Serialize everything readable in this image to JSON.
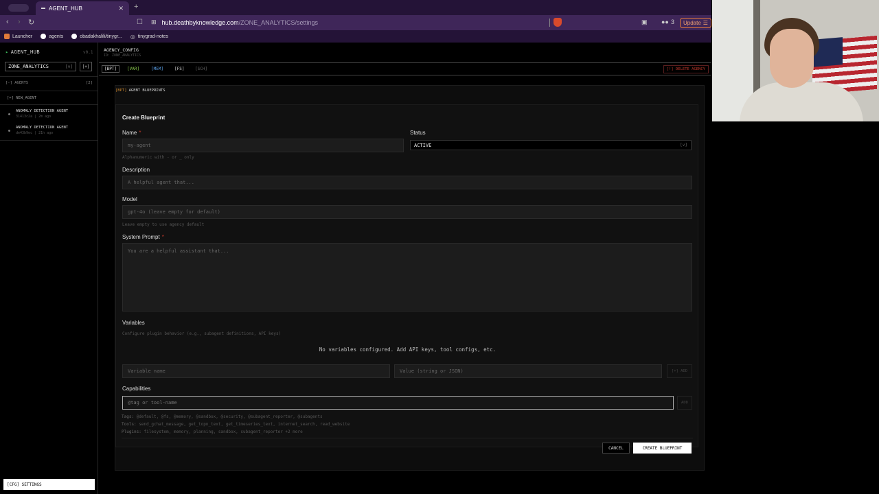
{
  "browser": {
    "tab_title": "AGENT_HUB",
    "url_host": "hub.deathbyknowledge.com",
    "url_path": "/ZONE_ANALYTICS/settings",
    "extensions_count": "3",
    "update_label": "Update",
    "bookmarks": [
      "Launcher",
      "agents",
      "obadakhalili/tinygr...",
      "tinygrad-notes"
    ]
  },
  "sidebar": {
    "brand": "AGENT_HUB",
    "version": "v0.1",
    "zone": "ZONE_ANALYTICS",
    "zone_chevron": "[v]",
    "zone_add": "[+]",
    "agents_header": "[-] AGENTS",
    "agents_count": "[2]",
    "new_agent": "[+] NEW_AGENT",
    "agents": [
      {
        "name": "ANOMALY DETECTION AGENT",
        "meta": "31413c2a | 2m ago"
      },
      {
        "name": "ANOMALY DETECTION AGENT",
        "meta": "de43b9ec | 21h ago"
      }
    ],
    "settings": "[CFG] SETTINGS"
  },
  "main": {
    "title": "AGENCY_CONFIG",
    "subtitle": "ID: ZONE_ANALYTICS",
    "tabs": [
      "[BPT]",
      "[VAR]",
      "[MEM]",
      "[FS]",
      "[SCH]"
    ],
    "alert": "[!] DELETE AGENCY",
    "section_tag": "[BPT]",
    "section_title": "AGENT BLUEPRINTS"
  },
  "form": {
    "title": "Create Blueprint",
    "name_label": "Name",
    "name_placeholder": "my-agent",
    "name_hint": "Alphanumeric with - or _ only",
    "status_label": "Status",
    "status_value": "ACTIVE",
    "status_chevron": "[v]",
    "description_label": "Description",
    "description_placeholder": "A helpful agent that...",
    "model_label": "Model",
    "model_placeholder": "gpt-4o (leave empty for default)",
    "model_hint": "Leave empty to use agency default",
    "prompt_label": "System Prompt",
    "prompt_placeholder": "You are a helpful assistant that...",
    "variables_label": "Variables",
    "variables_hint": "Configure plugin behavior (e.g., subagent definitions, API keys)",
    "variables_empty": "No variables configured. Add API keys, tool configs, etc.",
    "var_name_placeholder": "Variable name",
    "var_value_placeholder": "Value (string or JSON)",
    "var_add": "[+] ADD",
    "capabilities_label": "Capabilities",
    "cap_placeholder": "@tag or tool-name",
    "cap_add": "ADD",
    "tags_key": "Tags:",
    "tags": "@default, @fs, @memory, @sandbox, @security, @subagent_reporter, @subagents",
    "tools_key": "Tools:",
    "tools": "send_gchat_message, get_topn_text, get_timeseries_text, internet_search, read_website",
    "plugins_key": "Plugins:",
    "plugins": "filesystem, memory, planning, sandbox, subagent_reporter +2 more",
    "cancel": "CANCEL",
    "create": "CREATE BLUEPRINT"
  }
}
